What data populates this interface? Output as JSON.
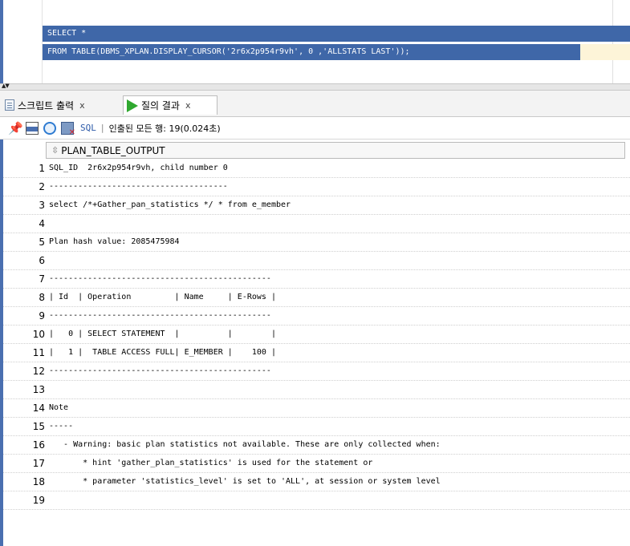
{
  "editor": {
    "lines": [
      "SELECT *",
      "FROM TABLE(DBMS_XPLAN.DISPLAY_CURSOR('2r6x2p954r9vh', 0 ,'ALLSTATS LAST'));"
    ]
  },
  "tabs": [
    {
      "label": "스크립트 출력",
      "close": "x",
      "icon": "script-output-icon",
      "active": false
    },
    {
      "label": "질의 결과",
      "close": "x",
      "icon": "run-play-icon",
      "active": true
    }
  ],
  "toolbar": {
    "sql_label": "SQL",
    "separator": "|",
    "status": "인출된 모든 행: 19(0.024초)"
  },
  "grid": {
    "column": "PLAN_TABLE_OUTPUT",
    "rows": [
      {
        "n": "1",
        "text": "SQL_ID  2r6x2p954r9vh, child number 0"
      },
      {
        "n": "2",
        "text": "-------------------------------------"
      },
      {
        "n": "3",
        "text": "select /*+Gather_pan_statistics */ * from e_member"
      },
      {
        "n": "4",
        "text": ""
      },
      {
        "n": "5",
        "text": "Plan hash value: 2085475984"
      },
      {
        "n": "6",
        "text": ""
      },
      {
        "n": "7",
        "text": "----------------------------------------------"
      },
      {
        "n": "8",
        "text": "| Id  | Operation         | Name     | E-Rows |"
      },
      {
        "n": "9",
        "text": "----------------------------------------------"
      },
      {
        "n": "10",
        "text": "|   0 | SELECT STATEMENT  |          |        |"
      },
      {
        "n": "11",
        "text": "|   1 |  TABLE ACCESS FULL| E_MEMBER |    100 |"
      },
      {
        "n": "12",
        "text": "----------------------------------------------"
      },
      {
        "n": "13",
        "text": ""
      },
      {
        "n": "14",
        "text": "Note"
      },
      {
        "n": "15",
        "text": "-----"
      },
      {
        "n": "16",
        "text": "   - Warning: basic plan statistics not available. These are only collected when:"
      },
      {
        "n": "17",
        "text": "       * hint 'gather_plan_statistics' is used for the statement or"
      },
      {
        "n": "18",
        "text": "       * parameter 'statistics_level' is set to 'ALL', at session or system level"
      },
      {
        "n": "19",
        "text": ""
      }
    ]
  }
}
